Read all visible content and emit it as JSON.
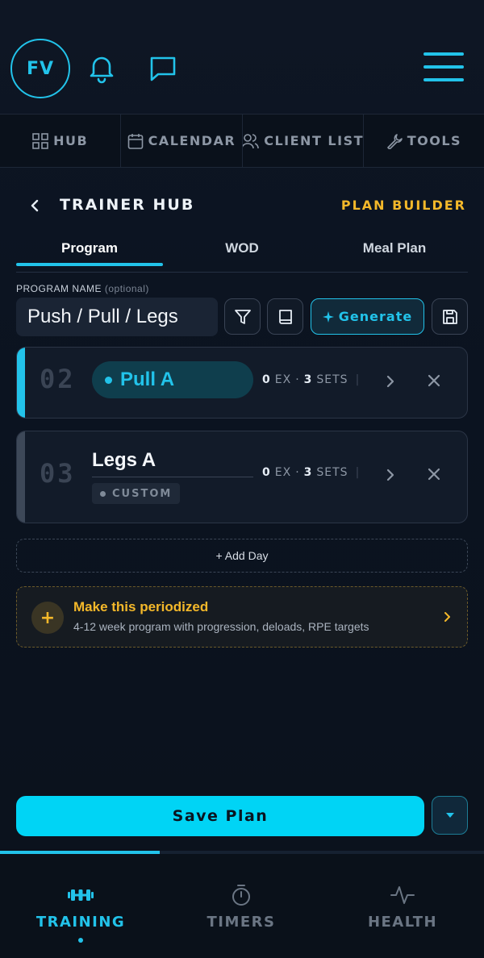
{
  "header": {
    "avatar_initials": "FV",
    "icons": [
      "bell-icon",
      "chat-icon",
      "menu-icon"
    ]
  },
  "nav_tabs": [
    {
      "label": "HUB",
      "icon": "grid-icon"
    },
    {
      "label": "CALENDAR",
      "icon": "calendar-icon"
    },
    {
      "label": "CLIENT LIST",
      "icon": "users-icon"
    },
    {
      "label": "TOOLS",
      "icon": "wrench-icon"
    }
  ],
  "hub": {
    "title": "TRAINER HUB",
    "mode_label": "PLAN BUILDER"
  },
  "sub_tabs": [
    {
      "label": "Program",
      "active": true
    },
    {
      "label": "WOD",
      "active": false
    },
    {
      "label": "Meal Plan",
      "active": false
    }
  ],
  "program": {
    "label": "PROGRAM NAME",
    "optional_label": "(optional)",
    "value": "Push / Pull / Legs",
    "generate_label": "Generate"
  },
  "days": [
    {
      "number": "02",
      "name": "Pull A",
      "ex_count": "0",
      "ex_label": "EX",
      "sets_count": "3",
      "sets_label": "SETS",
      "active": true
    },
    {
      "number": "03",
      "name": "Legs A",
      "tag": "CUSTOM",
      "ex_count": "0",
      "ex_label": "EX",
      "sets_count": "3",
      "sets_label": "SETS",
      "active": false
    }
  ],
  "add_day_label": "+ Add Day",
  "periodize": {
    "title": "Make this periodized",
    "subtitle": "4-12 week program with progression, deloads, RPE targets"
  },
  "save_label": "Save Plan",
  "bottom_nav": [
    {
      "label": "TRAINING",
      "icon": "dumbbell-icon",
      "active": true
    },
    {
      "label": "TIMERS",
      "icon": "stopwatch-icon",
      "active": false
    },
    {
      "label": "HEALTH",
      "icon": "activity-icon",
      "active": false
    }
  ],
  "progress": 0.33,
  "colors": {
    "accent": "#22c3ea",
    "save_button": "#00d4f5",
    "warning": "#f4b82a",
    "background": "#0b1320"
  }
}
